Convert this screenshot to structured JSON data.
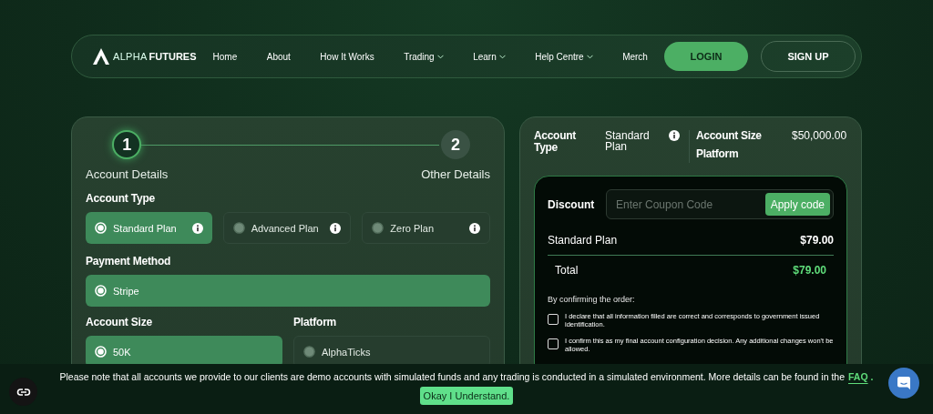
{
  "navbar": {
    "logo_light": "ALPHA",
    "logo_bold": "FUTURES",
    "links": [
      {
        "label": "Home",
        "dropdown": false
      },
      {
        "label": "About",
        "dropdown": false
      },
      {
        "label": "How It Works",
        "dropdown": false
      },
      {
        "label": "Trading",
        "dropdown": true
      },
      {
        "label": "Learn",
        "dropdown": true
      },
      {
        "label": "Help Centre",
        "dropdown": true
      },
      {
        "label": "Merch",
        "dropdown": false
      }
    ],
    "login": "LOGIN",
    "signup": "SIGN UP"
  },
  "stepper": [
    {
      "number": "1",
      "label": "Account Details",
      "selected": true
    },
    {
      "number": "2",
      "label": "Other Details",
      "selected": false
    }
  ],
  "account_type": {
    "label": "Account Type",
    "options": [
      {
        "label": "Standard Plan",
        "selected": true,
        "info": true
      },
      {
        "label": "Advanced Plan",
        "selected": false,
        "info": true
      },
      {
        "label": "Zero Plan",
        "selected": false,
        "info": true
      }
    ]
  },
  "payment_method": {
    "label": "Payment Method",
    "options": [
      {
        "label": "Stripe",
        "selected": true,
        "info": false
      }
    ]
  },
  "account_size": {
    "label": "Account Size",
    "options": [
      {
        "label": "50K",
        "selected": true,
        "info": false
      }
    ]
  },
  "platform": {
    "label": "Platform",
    "options": [
      {
        "label": "AlphaTicks",
        "selected": false,
        "info": false
      }
    ]
  },
  "summary": {
    "account_type_label": "Account Type",
    "account_type_value": "Standard Plan",
    "account_size_label": "Account Size",
    "account_size_value": "$50,000.00",
    "platform_label": "Platform"
  },
  "order": {
    "discount_label": "Discount",
    "coupon_placeholder": "Enter Coupon Code",
    "apply": "Apply code",
    "items": [
      {
        "label": "Standard Plan",
        "amount": "$79.00"
      }
    ],
    "total": {
      "label": "Total",
      "amount": "$79.00"
    },
    "confirm_intro": "By confirming the order:",
    "agreements": [
      {
        "text": "I declare that all information filled are correct and corresponds to government issued identification.",
        "checked": false
      },
      {
        "text": "I confirm this as my final account configuration decision. Any additional changes won't be allowed.",
        "checked": false
      }
    ]
  },
  "banner": {
    "text": "Please note that all accounts we provide to our clients are demo accounts with simulated funds and any trading is conducted in a simulated environment. More details can be found in the",
    "link": "FAQ",
    "after": ".",
    "button": "Okay I Understand."
  }
}
